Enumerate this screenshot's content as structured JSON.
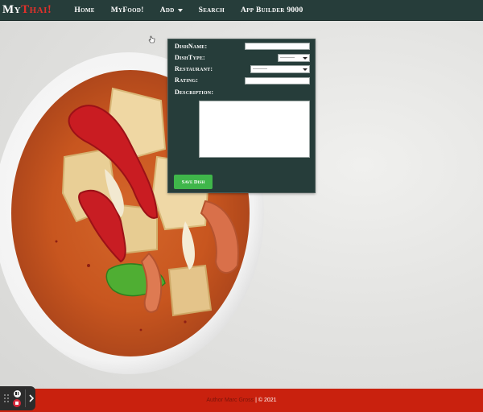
{
  "brand": {
    "part1": "My",
    "part2": "Thai!"
  },
  "nav": {
    "home": "Home",
    "myfood": "MyFood!",
    "add": "Add",
    "search": "Search",
    "app_builder": "App Builder 9000"
  },
  "form": {
    "dish_name_label": "DishName:",
    "dish_type_label": "DishType:",
    "dish_type_value": "---------",
    "restaurant_label": "Restaurant:",
    "restaurant_value": "---------",
    "rating_label": "Rating:",
    "description_label": "Description:",
    "save_label": "Save Dish"
  },
  "footer": {
    "author": "Author Marc Gross",
    "rest": "| © 2021"
  },
  "colors": {
    "navbar": "#263d3a",
    "brand_accent": "#e0312b",
    "save_button": "#3fb64a",
    "footer": "#c9210e"
  },
  "icons": [
    "caret-down-icon",
    "select-chevron-icon",
    "drag-grip-icon",
    "pause-icon",
    "stop-icon",
    "expand-arrow-icon",
    "hand-cursor-icon"
  ]
}
